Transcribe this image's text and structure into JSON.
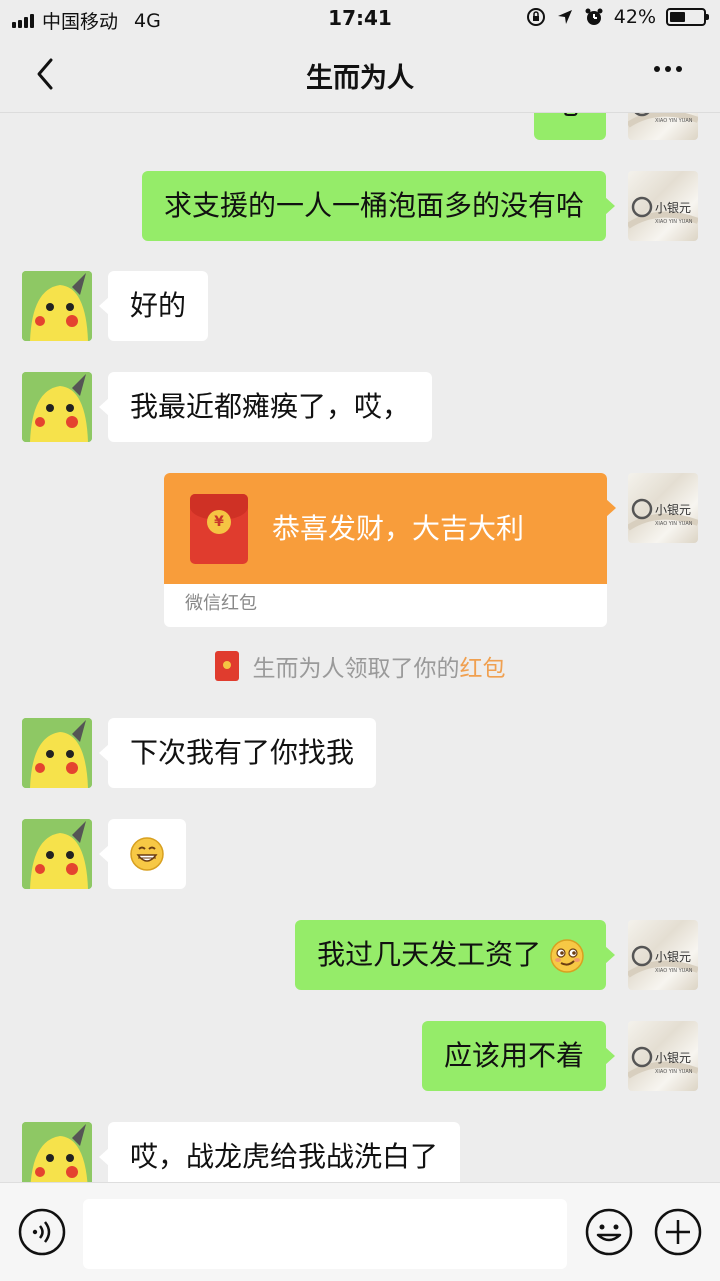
{
  "status_bar": {
    "carrier": "中国移动",
    "network": "4G",
    "time": "17:41",
    "battery": "42%"
  },
  "nav": {
    "title": "生而为人"
  },
  "messages": [
    {
      "side": "self",
      "text": "求支援的一人一桶泡面多的没有哈"
    },
    {
      "side": "other",
      "text": "好的"
    },
    {
      "side": "other",
      "text": "我最近都瘫痪了，哎，"
    },
    {
      "side": "self",
      "type": "red_packet",
      "text": "恭喜发财，大吉大利",
      "footer": "微信红包"
    },
    {
      "side": "other",
      "text": "下次我有了你找我"
    },
    {
      "side": "other",
      "type": "emoji",
      "emoji_name": "grin-emoji"
    },
    {
      "side": "self",
      "text": "我过几天发工资了",
      "emoji_name": "smirk-emoji"
    },
    {
      "side": "self",
      "text": "应该用不着"
    },
    {
      "side": "other",
      "text": "哎，战龙虎给我战洗白了"
    }
  ],
  "system_note": {
    "prefix": "生而为人领取了你的",
    "link": "红包"
  },
  "partial_top": {
    "text": "心"
  },
  "self_avatar": {
    "brand_cn": "小银元",
    "brand_en": "XIAO YIN YUAN"
  },
  "colors": {
    "self_bubble": "#95ec69",
    "other_bubble": "#ffffff",
    "red_packet": "#f89d3b",
    "background": "#ededed"
  },
  "input": {
    "value": "",
    "placeholder": ""
  }
}
